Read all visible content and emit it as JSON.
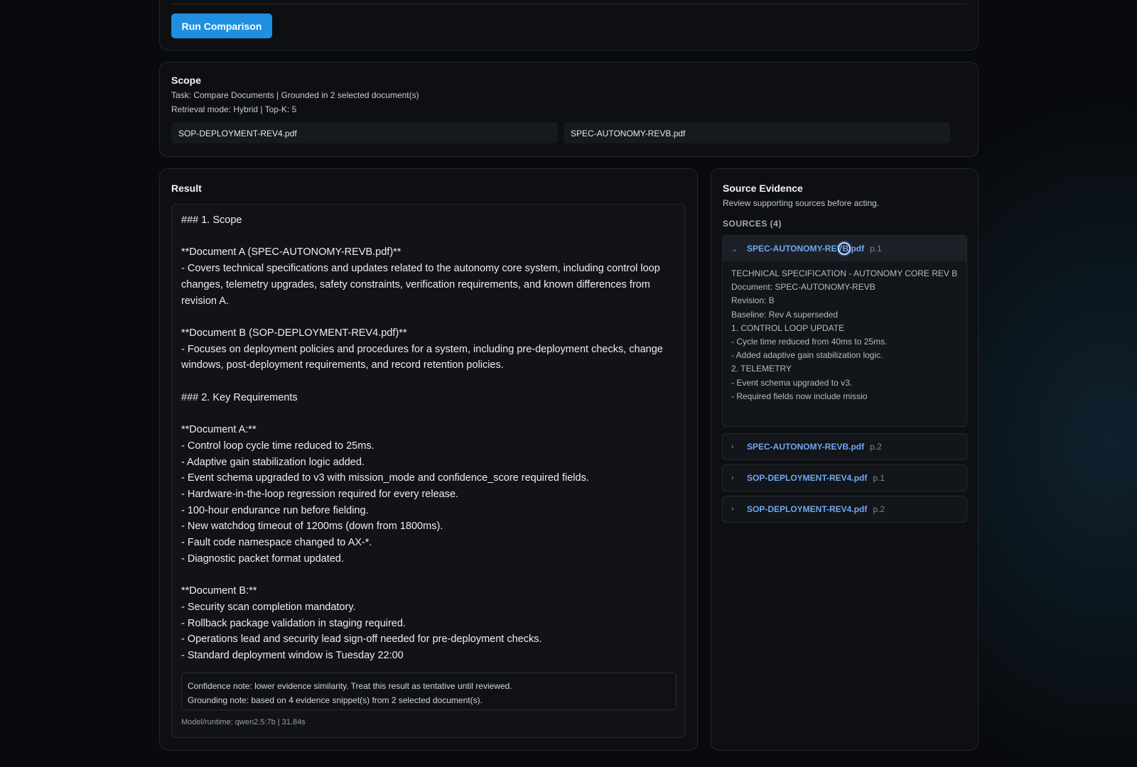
{
  "top": {
    "run_button_label": "Run Comparison"
  },
  "scope": {
    "title": "Scope",
    "task_line": "Task: Compare Documents | Grounded in 2 selected document(s)",
    "retrieval_line": "Retrieval mode: Hybrid | Top-K: 5",
    "documents": [
      "SOP-DEPLOYMENT-REV4.pdf",
      "SPEC-AUTONOMY-REVB.pdf"
    ]
  },
  "result": {
    "title": "Result",
    "text": "### 1. Scope\n\n**Document A (SPEC-AUTONOMY-REVB.pdf)**\n- Covers technical specifications and updates related to the autonomy core system, including control loop changes, telemetry upgrades, safety constraints, verification requirements, and known differences from revision A.\n\n**Document B (SOP-DEPLOYMENT-REV4.pdf)**\n- Focuses on deployment policies and procedures for a system, including pre-deployment checks, change windows, post-deployment requirements, and record retention policies.\n\n### 2. Key Requirements\n\n**Document A:**\n- Control loop cycle time reduced to 25ms.\n- Adaptive gain stabilization logic added.\n- Event schema upgraded to v3 with mission_mode and confidence_score required fields.\n- Hardware-in-the-loop regression required for every release.\n- 100-hour endurance run before fielding.\n- New watchdog timeout of 1200ms (down from 1800ms).\n- Fault code namespace changed to AX-*.\n- Diagnostic packet format updated.\n\n**Document B:**\n- Security scan completion mandatory.\n- Rollback package validation in staging required.\n- Operations lead and security lead sign-off needed for pre-deployment checks.\n- Standard deployment window is Tuesday 22:00",
    "confidence_note": "Confidence note: lower evidence similarity. Treat this result as tentative until reviewed.",
    "grounding_note": "Grounding note: based on 4 evidence snippet(s) from 2 selected document(s).",
    "runtime": "Model/runtime: qwen2.5:7b | 31.84s"
  },
  "evidence": {
    "title": "Source Evidence",
    "subtitle": "Review supporting sources before acting.",
    "sources_label": "SOURCES (4)",
    "sources": [
      {
        "file": "SPEC-AUTONOMY-REVB.pdf",
        "page": "p.1",
        "expanded": true,
        "icon": "chevron-down-icon",
        "lines": [
          "TECHNICAL SPECIFICATION - AUTONOMY CORE REV B",
          "Document: SPEC-AUTONOMY-REVB",
          "Revision: B",
          "Baseline: Rev A superseded",
          "1. CONTROL LOOP UPDATE",
          "- Cycle time reduced from 40ms to 25ms.",
          "- Added adaptive gain stabilization logic.",
          "2. TELEMETRY",
          "- Event schema upgraded to v3.",
          "- Required fields now include missio"
        ]
      },
      {
        "file": "SPEC-AUTONOMY-REVB.pdf",
        "page": "p.2",
        "expanded": false,
        "icon": "chevron-right-icon"
      },
      {
        "file": "SOP-DEPLOYMENT-REV4.pdf",
        "page": "p.1",
        "expanded": false,
        "icon": "chevron-right-icon"
      },
      {
        "file": "SOP-DEPLOYMENT-REV4.pdf",
        "page": "p.2",
        "expanded": false,
        "icon": "chevron-right-icon"
      }
    ]
  },
  "colors": {
    "accent": "#1e8fe1",
    "link": "#6fa8f0",
    "background": "#080a0d",
    "panel": "#0d0f12"
  }
}
